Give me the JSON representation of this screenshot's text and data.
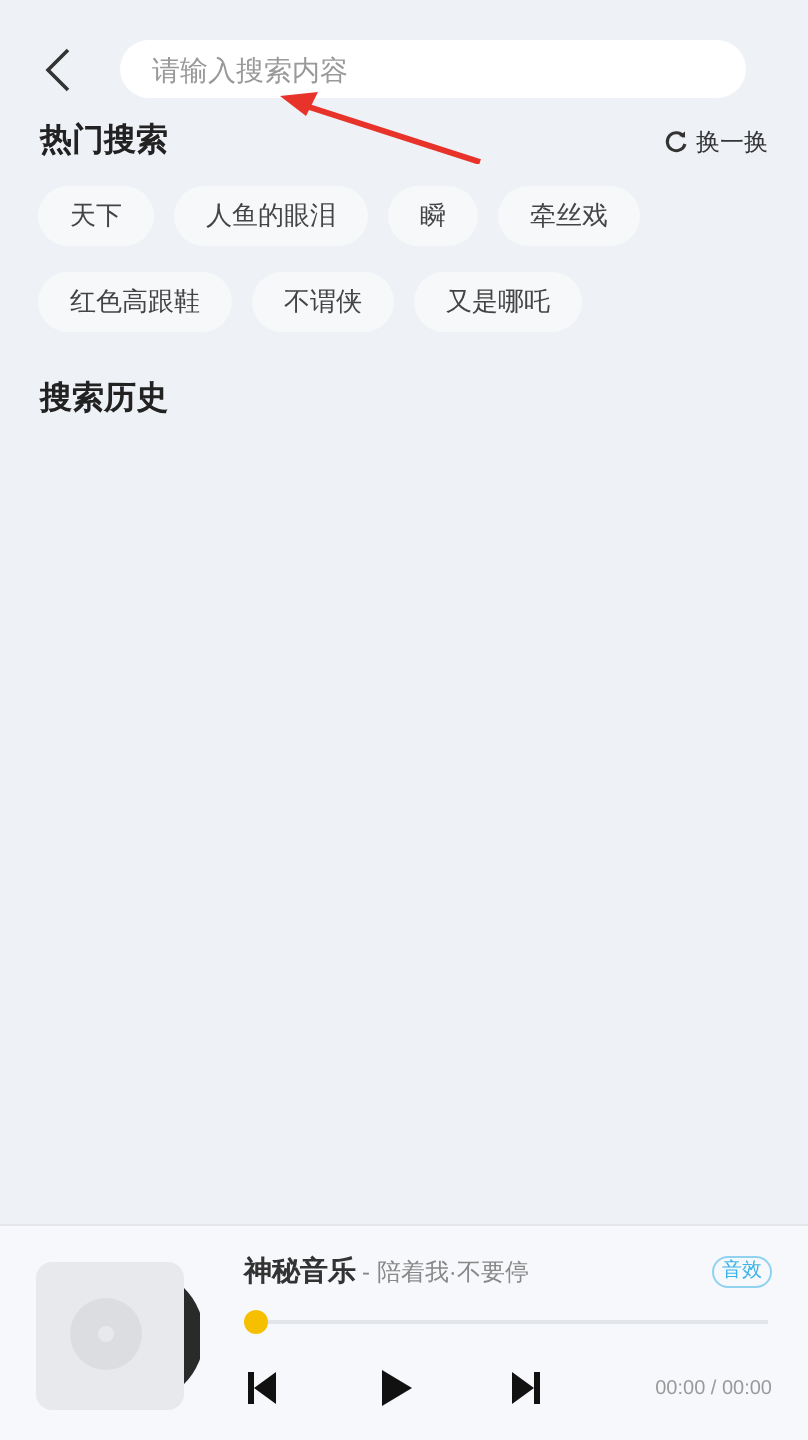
{
  "search": {
    "placeholder": "请输入搜索内容"
  },
  "hot": {
    "title": "热门搜索",
    "refresh": "换一换",
    "tags": [
      {
        "label": "天下"
      },
      {
        "label": "人鱼的眼泪"
      },
      {
        "label": "瞬"
      },
      {
        "label": "牵丝戏"
      },
      {
        "label": "红色高跟鞋"
      },
      {
        "label": "不谓侠"
      },
      {
        "label": "又是哪吒"
      }
    ]
  },
  "history": {
    "title": "搜索历史"
  },
  "player": {
    "title": "神秘音乐",
    "subtitle": "- 陪着我·不要停",
    "effect": "音效",
    "level": 0,
    "time": "00:00 / 00:00"
  }
}
